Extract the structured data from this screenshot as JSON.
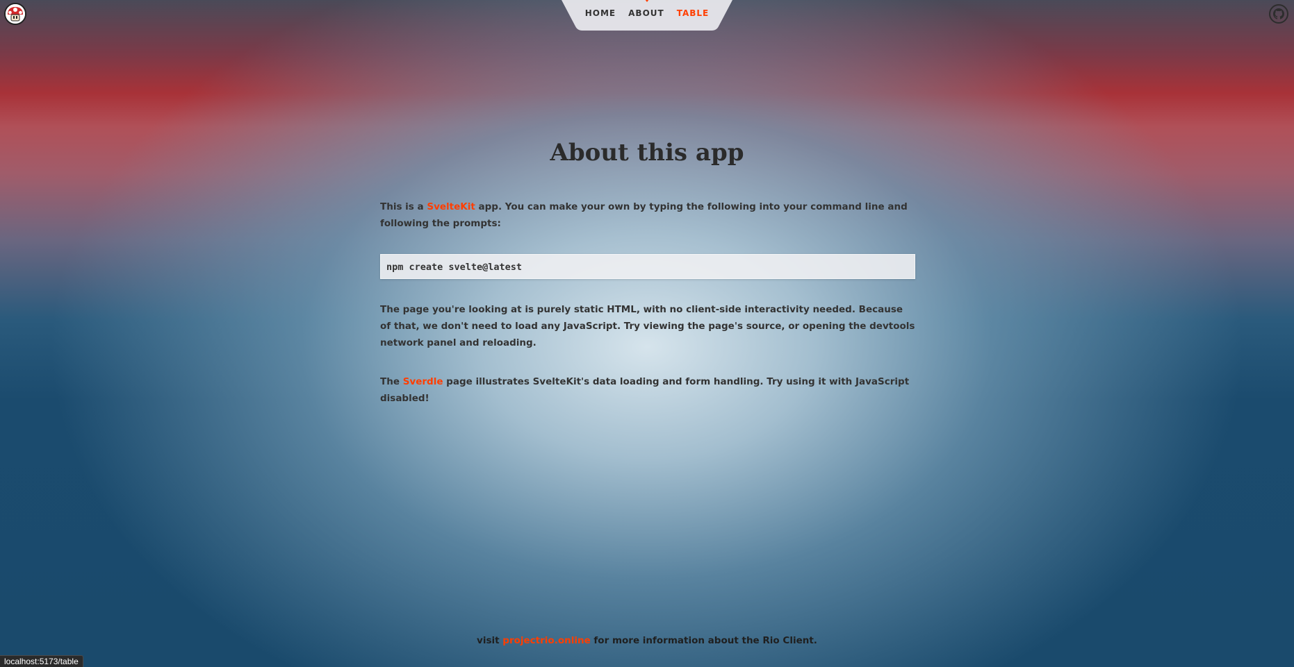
{
  "logo": {
    "icon": "mushroom-icon"
  },
  "nav": {
    "items": [
      {
        "label": "HOME",
        "active": false
      },
      {
        "label": "ABOUT",
        "active": false
      },
      {
        "label": "TABLE",
        "active": true
      }
    ]
  },
  "github": {
    "icon": "github-icon"
  },
  "main": {
    "title": "About this app",
    "p1": {
      "pre": "This is a ",
      "link": "SvelteKit",
      "post": " app. You can make your own by typing the following into your command line and following the prompts:"
    },
    "code": "npm create svelte@latest",
    "p2": "The page you're looking at is purely static HTML, with no client-side interactivity needed. Because of that, we don't need to load any JavaScript. Try viewing the page's source, or opening the devtools network panel and reloading.",
    "p3": {
      "pre": "The ",
      "link": "Sverdle",
      "post": " page illustrates SvelteKit's data loading and form handling. Try using it with JavaScript disabled!"
    }
  },
  "footer": {
    "pre": "visit ",
    "link": "projectrio.online",
    "post": " for more information about the Rio Client."
  },
  "status_bar": {
    "url": "localhost:5173/table"
  },
  "colors": {
    "accent": "#ff3e00",
    "text": "#333333"
  }
}
